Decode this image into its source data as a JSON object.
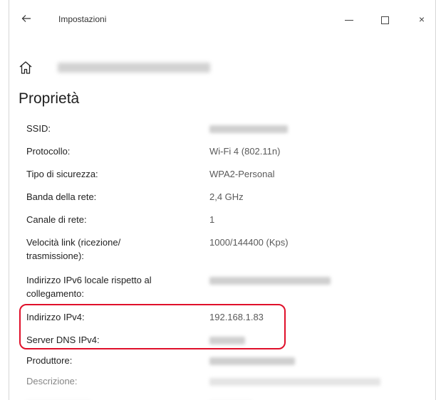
{
  "window": {
    "title": "Impostazioni",
    "back_icon": "arrow-left-icon",
    "minimize_icon": "minimize-icon",
    "maximize_icon": "maximize-icon",
    "close_icon": "close-icon",
    "close_glyph": "×"
  },
  "header": {
    "home_icon": "home-icon"
  },
  "page": {
    "title": "Proprietà"
  },
  "properties": [
    {
      "label": "SSID:",
      "value": ""
    },
    {
      "label": "Protocollo:",
      "value": "Wi-Fi 4 (802.11n)"
    },
    {
      "label": "Tipo di sicurezza:",
      "value": "WPA2-Personal"
    },
    {
      "label": "Banda della rete:",
      "value": "2,4 GHz"
    },
    {
      "label": "Canale di rete:",
      "value": "1"
    },
    {
      "label": "Velocità link (ricezione/ trasmissione):",
      "value": "1000/144400 (Kps)"
    },
    {
      "label": "Indirizzo IPv6 locale rispetto al collegamento:",
      "value": ""
    },
    {
      "label": "Indirizzo IPv4:",
      "value": "192.168.1.83"
    },
    {
      "label": "Server DNS IPv4:",
      "value": ""
    },
    {
      "label": "Produttore:",
      "value": ""
    },
    {
      "label": "Descrizione:",
      "value": ""
    }
  ],
  "colors": {
    "highlight": "#e0102a",
    "value_text": "#5a5a5a"
  }
}
